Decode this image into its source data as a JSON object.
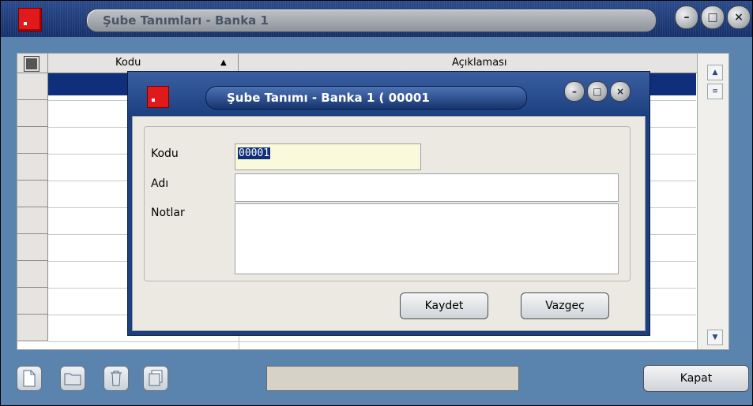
{
  "window": {
    "title": "Şube Tanımları - Banka 1"
  },
  "grid": {
    "columns": [
      {
        "label": "Kodu",
        "sort": "ascending"
      },
      {
        "label": "Açıklaması"
      }
    ]
  },
  "toolbar": {
    "tools": [
      "new-document-icon",
      "open-folder-icon",
      "trash-icon",
      "copy-icon"
    ],
    "close_label": "Kapat"
  },
  "dialog": {
    "title": "Şube Tanımı - Banka 1 ( 00001",
    "fields": {
      "kodu_label": "Kodu",
      "kodu_value": "00001",
      "adi_label": "Adı",
      "adi_value": "",
      "notlar_label": "Notlar",
      "notlar_value": ""
    },
    "buttons": {
      "save_label": "Kaydet",
      "cancel_label": "Vazgeç"
    }
  }
}
